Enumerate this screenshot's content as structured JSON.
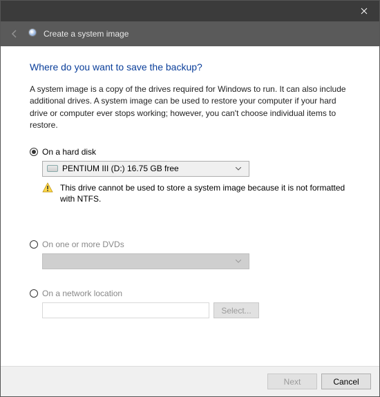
{
  "titlebar": {},
  "header": {
    "wizard_title": "Create a system image"
  },
  "main": {
    "heading": "Where do you want to save the backup?",
    "description": "A system image is a copy of the drives required for Windows to run. It can also include additional drives. A system image can be used to restore your computer if your hard drive or computer ever stops working; however, you can't choose individual items to restore.",
    "options": {
      "hard_disk": {
        "label": "On a hard disk",
        "selected_drive": "PENTIUM III (D:)  16.75 GB free",
        "warning": "This drive cannot be used to store a system image because it is not formatted with NTFS."
      },
      "dvd": {
        "label": "On one or more DVDs",
        "dropdown_value": ""
      },
      "network": {
        "label": "On a network location",
        "path_value": "",
        "select_button": "Select..."
      }
    }
  },
  "footer": {
    "next": "Next",
    "cancel": "Cancel"
  }
}
